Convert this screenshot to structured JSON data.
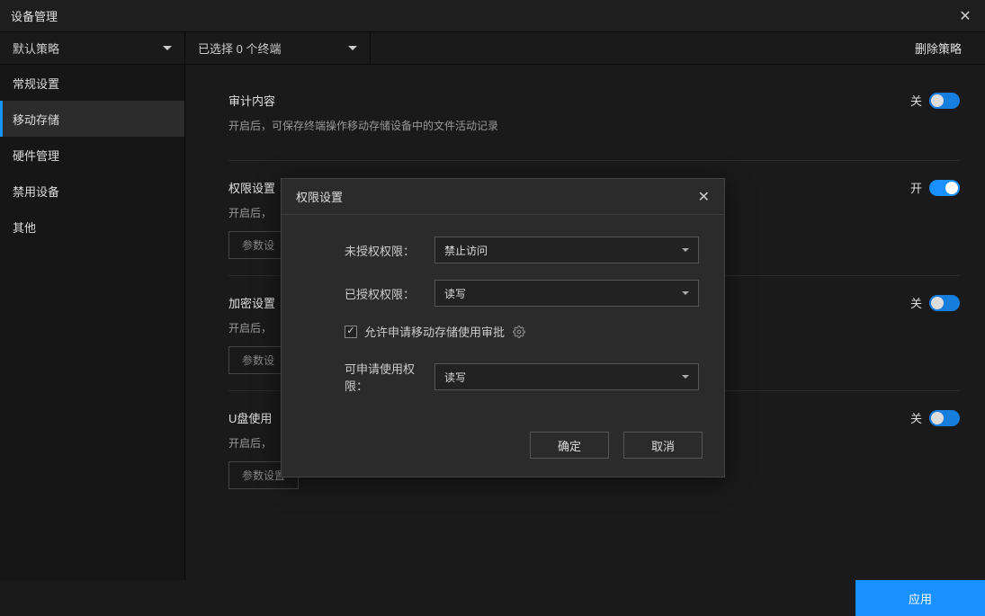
{
  "window": {
    "title": "设备管理"
  },
  "toolbar": {
    "strategy_label": "默认策略",
    "selection_label": "已选择 0 个终端",
    "delete_label": "删除策略"
  },
  "sidebar": {
    "items": [
      {
        "label": "常规设置"
      },
      {
        "label": "移动存储"
      },
      {
        "label": "硬件管理"
      },
      {
        "label": "禁用设备"
      },
      {
        "label": "其他"
      }
    ]
  },
  "content": {
    "sections": [
      {
        "title": "审计内容",
        "desc": "开启后，可保存终端操作移动存储设备中的文件活动记录",
        "state_label": "关",
        "state": "off",
        "has_param": false,
        "param_label": ""
      },
      {
        "title": "权限设置",
        "desc": "开启后，",
        "state_label": "开",
        "state": "on",
        "has_param": true,
        "param_label": "参数设"
      },
      {
        "title": "加密设置",
        "desc": "开启后，",
        "state_label": "关",
        "state": "off",
        "has_param": true,
        "param_label": "参数设"
      },
      {
        "title": "U盘使用",
        "desc": "开启后，",
        "state_label": "关",
        "state": "off",
        "has_param": true,
        "param_label": "参数设置"
      }
    ]
  },
  "footer": {
    "apply_label": "应用"
  },
  "modal": {
    "title": "权限设置",
    "rows": {
      "unauth_label": "未授权权限：",
      "unauth_value": "禁止访问",
      "auth_label": "已授权权限：",
      "auth_value": "读写",
      "allow_apply_label": "允许申请移动存储使用审批",
      "allow_apply_checked": true,
      "requestable_label": "可申请使用权限：",
      "requestable_value": "读写"
    },
    "ok": "确定",
    "cancel": "取消"
  }
}
